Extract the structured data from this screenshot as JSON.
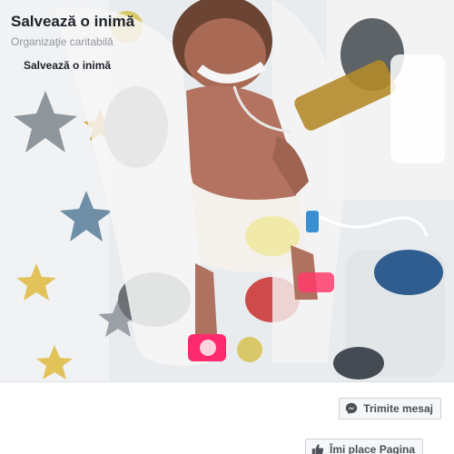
{
  "page": {
    "name": "Salvează o inimă",
    "category": "Organizaţie caritabilă",
    "name_small": "Salvează o inimă"
  },
  "actions": {
    "message_label": "Trimite mesaj",
    "message_icon": "messenger-icon",
    "like_label": "Îmi place Pagina",
    "like_icon": "thumbs-up-icon"
  },
  "colors": {
    "text_primary": "#1d2129",
    "text_secondary": "#90949c",
    "button_bg": "#f6f7f9",
    "button_border": "#ced0d4",
    "pulse_oximeter_light": "#ff2a6d"
  }
}
